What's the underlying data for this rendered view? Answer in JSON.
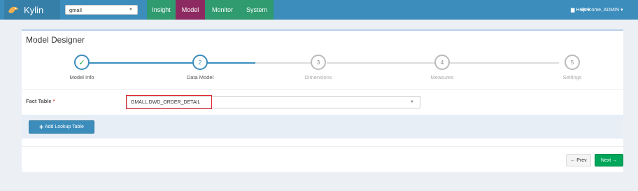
{
  "navbar": {
    "brand": "Kylin",
    "project": "gmall",
    "tabs": [
      {
        "label": "Insight"
      },
      {
        "label": "Model"
      },
      {
        "label": "Monitor"
      },
      {
        "label": "System"
      }
    ],
    "help": "Help",
    "welcome": "Welcome, ADMIN"
  },
  "panel": {
    "title": "Model Designer",
    "steps": [
      {
        "number": "✓",
        "label": "Model Info"
      },
      {
        "number": "2",
        "label": "Data Model"
      },
      {
        "number": "3",
        "label": "Dimensions"
      },
      {
        "number": "4",
        "label": "Measures"
      },
      {
        "number": "5",
        "label": "Settings"
      }
    ],
    "fact_table_label": "Fact Table",
    "fact_table_required": "*",
    "fact_table_value": "GMALL.DWD_ORDER_DETAIL",
    "add_lookup_label": "Add Lookup Table",
    "prev_label": "Prev",
    "next_label": "Next"
  },
  "colors": {
    "navbar": "#3c8dbc",
    "model_tab": "#8e2a62",
    "tab_bar": "#2f9b6f",
    "next": "#00a65a",
    "highlight": "#e0232f"
  }
}
